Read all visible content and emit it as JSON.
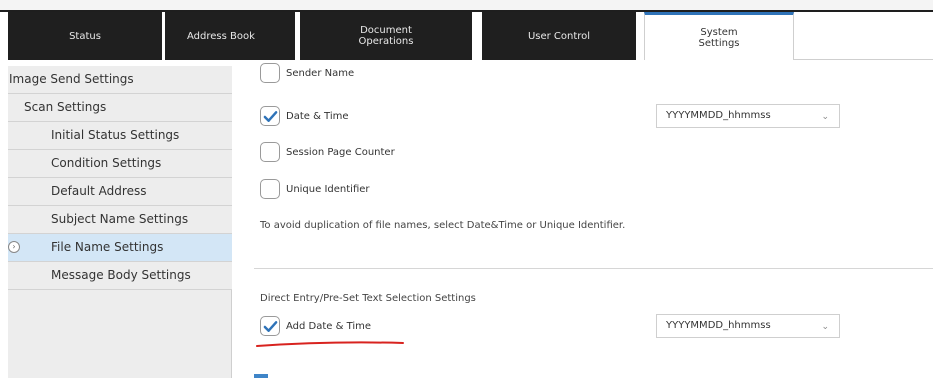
{
  "tabs": [
    {
      "label": "Status"
    },
    {
      "label": "Address Book"
    },
    {
      "label": "Document\nOperations"
    },
    {
      "label": "User Control"
    },
    {
      "label": "System\nSettings"
    }
  ],
  "sidebar": {
    "items": [
      {
        "label": "Image Send Settings"
      },
      {
        "label": "Scan Settings"
      },
      {
        "label": "Initial Status Settings"
      },
      {
        "label": "Condition Settings"
      },
      {
        "label": "Default Address"
      },
      {
        "label": "Subject Name Settings"
      },
      {
        "label": "File Name Settings",
        "active": true
      },
      {
        "label": "Message Body Settings"
      }
    ],
    "active_arrow": "›"
  },
  "file_name": {
    "options": [
      {
        "label": "Sender Name",
        "checked": false
      },
      {
        "label": "Date & Time",
        "checked": true,
        "format": "YYYYMMDD_hhmmss"
      },
      {
        "label": "Session Page Counter",
        "checked": false
      },
      {
        "label": "Unique Identifier",
        "checked": false
      }
    ],
    "note": "To avoid duplication of file names, select Date&Time or Unique Identifier."
  },
  "direct_entry": {
    "title": "Direct Entry/Pre-Set Text Selection Settings",
    "add_date_time": {
      "label": "Add Date & Time",
      "checked": true,
      "format": "YYYYMMDD_hhmmss"
    }
  },
  "colors": {
    "tab_bg": "#1f1f1f",
    "active_tab_border": "#2f73b8",
    "checkmark": "#2f73b8",
    "active_sidebar": "#d3e6f6",
    "annotation_underline": "#d8231f"
  },
  "icons": {
    "select_chevron": "chevron-down-icon",
    "checkbox_check": "checkmark-icon",
    "active_item": "chevron-right-circle-icon"
  }
}
